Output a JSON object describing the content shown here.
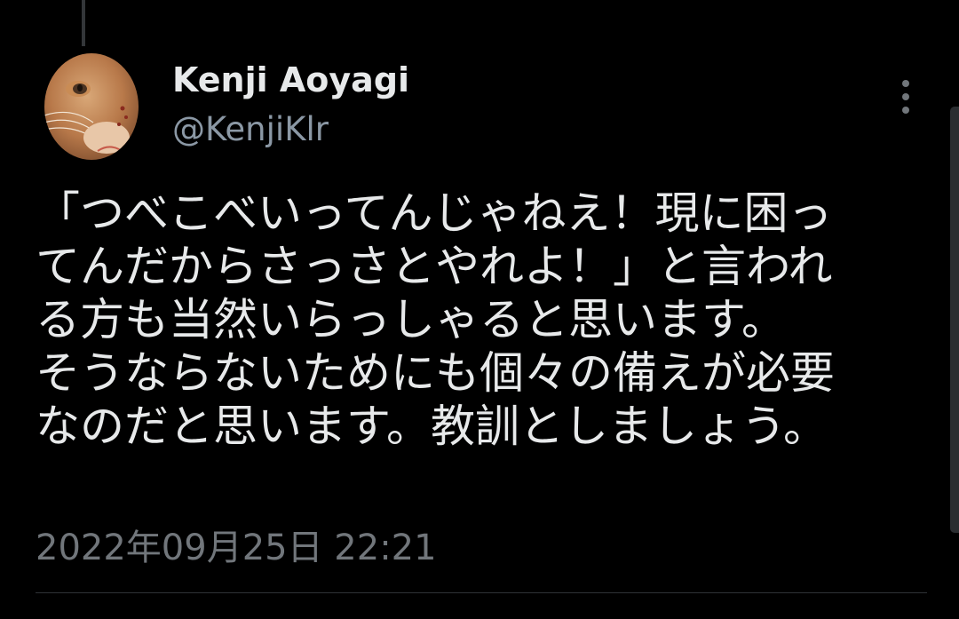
{
  "author": {
    "display_name": "Kenji Aoyagi",
    "handle": "@KenjiKlr",
    "avatar_icon": "cat-avatar"
  },
  "tweet": {
    "lines": [
      "「つべこべいってんじゃねえ！現に困っ",
      "てんだからさっさとやれよ！」と言われ",
      "る方も当然いらっしゃると思います。",
      "そうならないためにも個々の備えが必要",
      "なのだと思います。教訓としましょう。"
    ],
    "timestamp": "2022年09月25日 22:21"
  },
  "controls": {
    "more_icon": "more-vertical-icon"
  },
  "colors": {
    "background": "#000000",
    "primary_text": "#e7e9ea",
    "secondary_text": "#71767b",
    "handle_text": "#8b98a5",
    "divider": "#2f3336"
  }
}
